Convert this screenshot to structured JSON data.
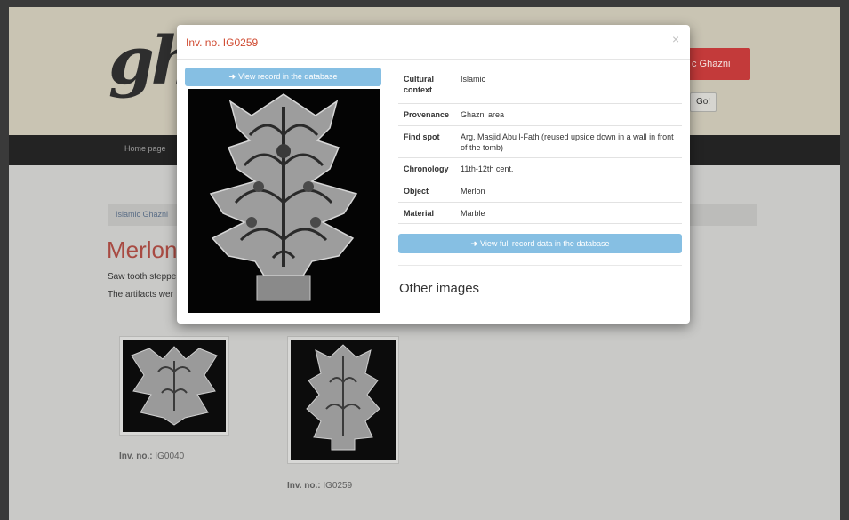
{
  "background": {
    "logo_text": "gh",
    "brand_button": "c Ghazni",
    "go_button": "Go!",
    "nav_home": "Home page",
    "breadcrumb": "Islamic Ghazni",
    "page_title": "Merlon",
    "description_line1": "Saw tooth steppe",
    "description_line2": "The artifacts wer",
    "thumbnails": [
      {
        "caption_label": "Inv. no.:",
        "caption_value": "IG0040"
      },
      {
        "caption_label": "Inv. no.:",
        "caption_value": "IG0259"
      }
    ]
  },
  "modal": {
    "title": "Inv. no. IG0259",
    "close_glyph": "×",
    "view_record_label": "View record in the database",
    "view_full_label": "View full record data in the database",
    "other_images_heading": "Other images",
    "arrow_glyph": "➜",
    "fields": [
      {
        "label": "Cultural context",
        "value": "Islamic"
      },
      {
        "label": "Provenance",
        "value": "Ghazni area"
      },
      {
        "label": "Find spot",
        "value": "Arg, Masjid Abu l-Fath (reused upside down in a wall in front of the tomb)"
      },
      {
        "label": "Chronology",
        "value": "11th-12th cent."
      },
      {
        "label": "Object",
        "value": "Merlon"
      },
      {
        "label": "Material",
        "value": "Marble"
      }
    ]
  },
  "colors": {
    "accent_red": "#d04b32",
    "button_blue": "#86bfe3",
    "navbar": "#232323",
    "overlay_page": "#c9c9c7"
  }
}
